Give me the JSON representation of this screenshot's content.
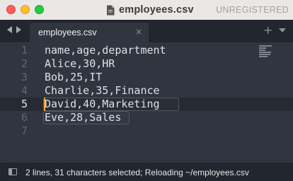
{
  "window": {
    "title": "employees.csv",
    "license_label": "UNREGISTERED"
  },
  "tabs": [
    {
      "label": "employees.csv",
      "close_glyph": "×"
    }
  ],
  "tab_bar": {
    "add_glyph": "+"
  },
  "editor": {
    "active_line": 5,
    "lines": [
      {
        "number": "1",
        "text": "name,age,department"
      },
      {
        "number": "2",
        "text": "Alice,30,HR"
      },
      {
        "number": "3",
        "text": "Bob,25,IT"
      },
      {
        "number": "4",
        "text": "Charlie,35,Finance"
      },
      {
        "number": "5",
        "text": "David,40,Marketing"
      },
      {
        "number": "6",
        "text": "Eve,28,Sales"
      },
      {
        "number": "7",
        "text": ""
      }
    ]
  },
  "status_bar": {
    "text": "2 lines, 31 characters selected; Reloading ~/employees.csv"
  },
  "colors": {
    "editor_bg": "#303540",
    "active_line_bg": "#262a33",
    "caret": "#f5a623",
    "text": "#dde1e6"
  },
  "icons": [
    "document-icon",
    "chevron-left-icon",
    "chevron-right-icon",
    "close-icon",
    "plus-icon",
    "chevron-down-icon",
    "sidebar-toggle-icon"
  ]
}
